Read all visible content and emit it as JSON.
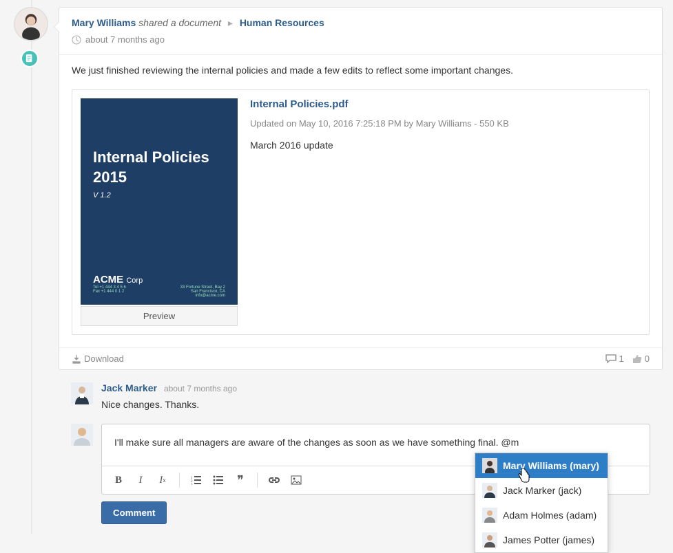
{
  "post": {
    "author": "Mary Williams",
    "action": "shared a document",
    "location": "Human Resources",
    "timestamp": "about 7 months ago",
    "body": "We just finished reviewing the internal policies and made a few edits to reflect some important changes."
  },
  "attachment": {
    "title": "Internal Policies.pdf",
    "meta": "Updated on May 10, 2016 7:25:18 PM by Mary Williams - 550 KB",
    "description": "March 2016 update",
    "preview_label": "Preview",
    "doc_title_l1": "Internal Policies",
    "doc_title_l2": "2015",
    "doc_version": "V 1.2",
    "doc_brand_bold": "ACME",
    "doc_brand_light": "Corp"
  },
  "footer": {
    "download": "Download",
    "comment_count": "1",
    "like_count": "0"
  },
  "comments": [
    {
      "author": "Jack Marker",
      "timestamp": "about 7 months ago",
      "text": "Nice changes. Thanks."
    }
  ],
  "reply": {
    "draft": "I'll make sure all managers are aware of the changes as soon as we have something final. @m",
    "submit": "Comment"
  },
  "mentions": [
    {
      "label": "Mary Williams (mary)",
      "selected": true
    },
    {
      "label": "Jack Marker (jack)",
      "selected": false
    },
    {
      "label": "Adam Holmes (adam)",
      "selected": false
    },
    {
      "label": "James Potter (james)",
      "selected": false
    }
  ]
}
